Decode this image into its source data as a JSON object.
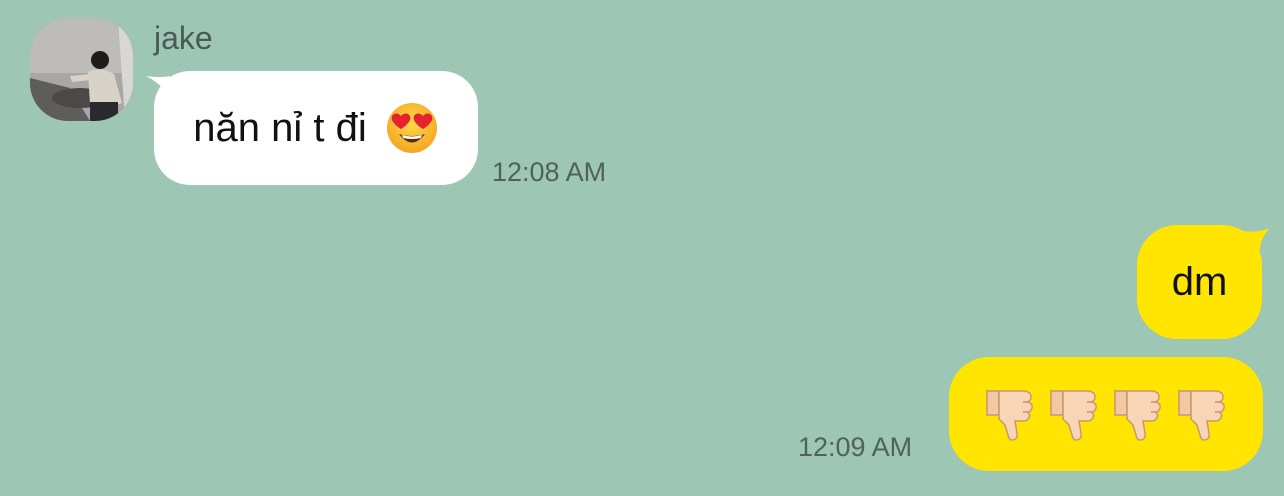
{
  "chat": {
    "sender": {
      "name": "jake",
      "avatar_icon": "user-photo-avatar"
    },
    "messages": [
      {
        "direction": "incoming",
        "text": "năn nỉ t đi",
        "emoji_icon": "heart-eyes-emoji",
        "time": "12:08 AM"
      },
      {
        "direction": "outgoing",
        "text": "dm"
      },
      {
        "direction": "outgoing",
        "emoji_icons": [
          "thumbs-down-emoji",
          "thumbs-down-emoji",
          "thumbs-down-emoji",
          "thumbs-down-emoji"
        ],
        "time": "12:09 AM"
      }
    ]
  },
  "colors": {
    "background": "#9dc6b5",
    "incoming_bubble": "#ffffff",
    "outgoing_bubble": "#ffe500",
    "timestamp": "#4f625b"
  }
}
